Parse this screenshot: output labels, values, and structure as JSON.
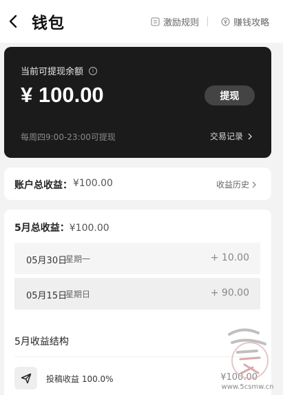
{
  "header": {
    "title": "钱包",
    "back_icon": "chevron-left-icon",
    "links": [
      {
        "label": "激励规则",
        "icon": "rules-doc-icon"
      },
      {
        "label": "赚钱攻略",
        "icon": "yen-coin-icon"
      }
    ]
  },
  "balance": {
    "label": "当前可提现余额",
    "amount": "¥ 100.00",
    "withdraw_label": "提现",
    "note": "每周四9:00-23:00可提现",
    "transactions_label": "交易记录"
  },
  "total": {
    "label": "账户总收益：",
    "value": "¥100.00",
    "history_label": "收益历史"
  },
  "month": {
    "title_label": "5月总收益：",
    "title_value": "¥100.00",
    "days": [
      {
        "date": "05月30日",
        "weekday": "星期一",
        "amount": "+ 10.00"
      },
      {
        "date": "05月15日",
        "weekday": "星期日",
        "amount": "+ 90.00"
      }
    ],
    "structure_title": "5月收益结构",
    "structure": {
      "label": "投稿收益 100.0%",
      "amount": "¥100.00",
      "icon": "paper-plane-icon"
    }
  },
  "watermark": {
    "site": "www.5csmw.cn"
  },
  "colors": {
    "card_dark": "#1b1b1b",
    "page_bg": "#f3f3f3",
    "button_dark": "#444444"
  }
}
